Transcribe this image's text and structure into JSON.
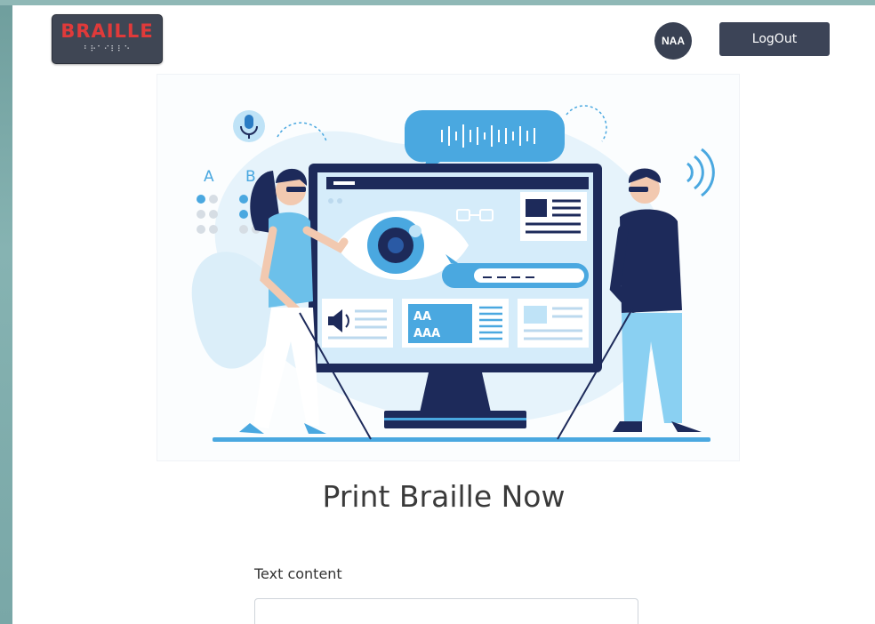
{
  "header": {
    "logo_text": "BRAILLE",
    "avatar_initials": "NAA",
    "logout_label": "LogOut"
  },
  "hero": {
    "label_a": "A",
    "label_b": "B",
    "screen_text_1": "AA",
    "screen_text_2": "AAA"
  },
  "main": {
    "title": "Print Braille Now",
    "text_content_label": "Text content",
    "text_content_value": ""
  },
  "colors": {
    "header_dark": "#3c4457",
    "logo_red": "#e03a3a",
    "illustration_blue": "#4aa8e0",
    "illustration_navy": "#1d2a5a"
  }
}
